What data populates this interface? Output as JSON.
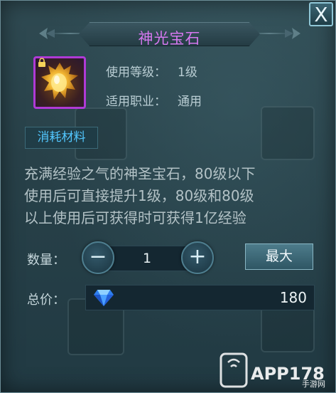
{
  "dialog": {
    "title": "神光宝石",
    "close_label": "X"
  },
  "item": {
    "icon_name": "golden-gem-icon",
    "level_label": "使用等级：",
    "level_value": "1级",
    "class_label": "适用职业：",
    "class_value": "通用",
    "tag": "消耗材料",
    "description_lines": [
      "充满经验之气的神圣宝石，80级以下",
      "使用后可直接提升1级，80级和80级",
      "以上使用后可获得时可获得1亿经验"
    ]
  },
  "purchase": {
    "quantity_label": "数量：",
    "minus_label": "−",
    "plus_label": "+",
    "quantity_value": "1",
    "max_label": "最大",
    "total_label": "总价：",
    "currency_icon": "diamond-icon",
    "total_value": "180"
  },
  "watermark": {
    "text_main": "APP178",
    "text_sub": "手游网"
  },
  "colors": {
    "title": "#d678f0",
    "tag": "#52c7ff",
    "item_border": "#b03ad6"
  }
}
